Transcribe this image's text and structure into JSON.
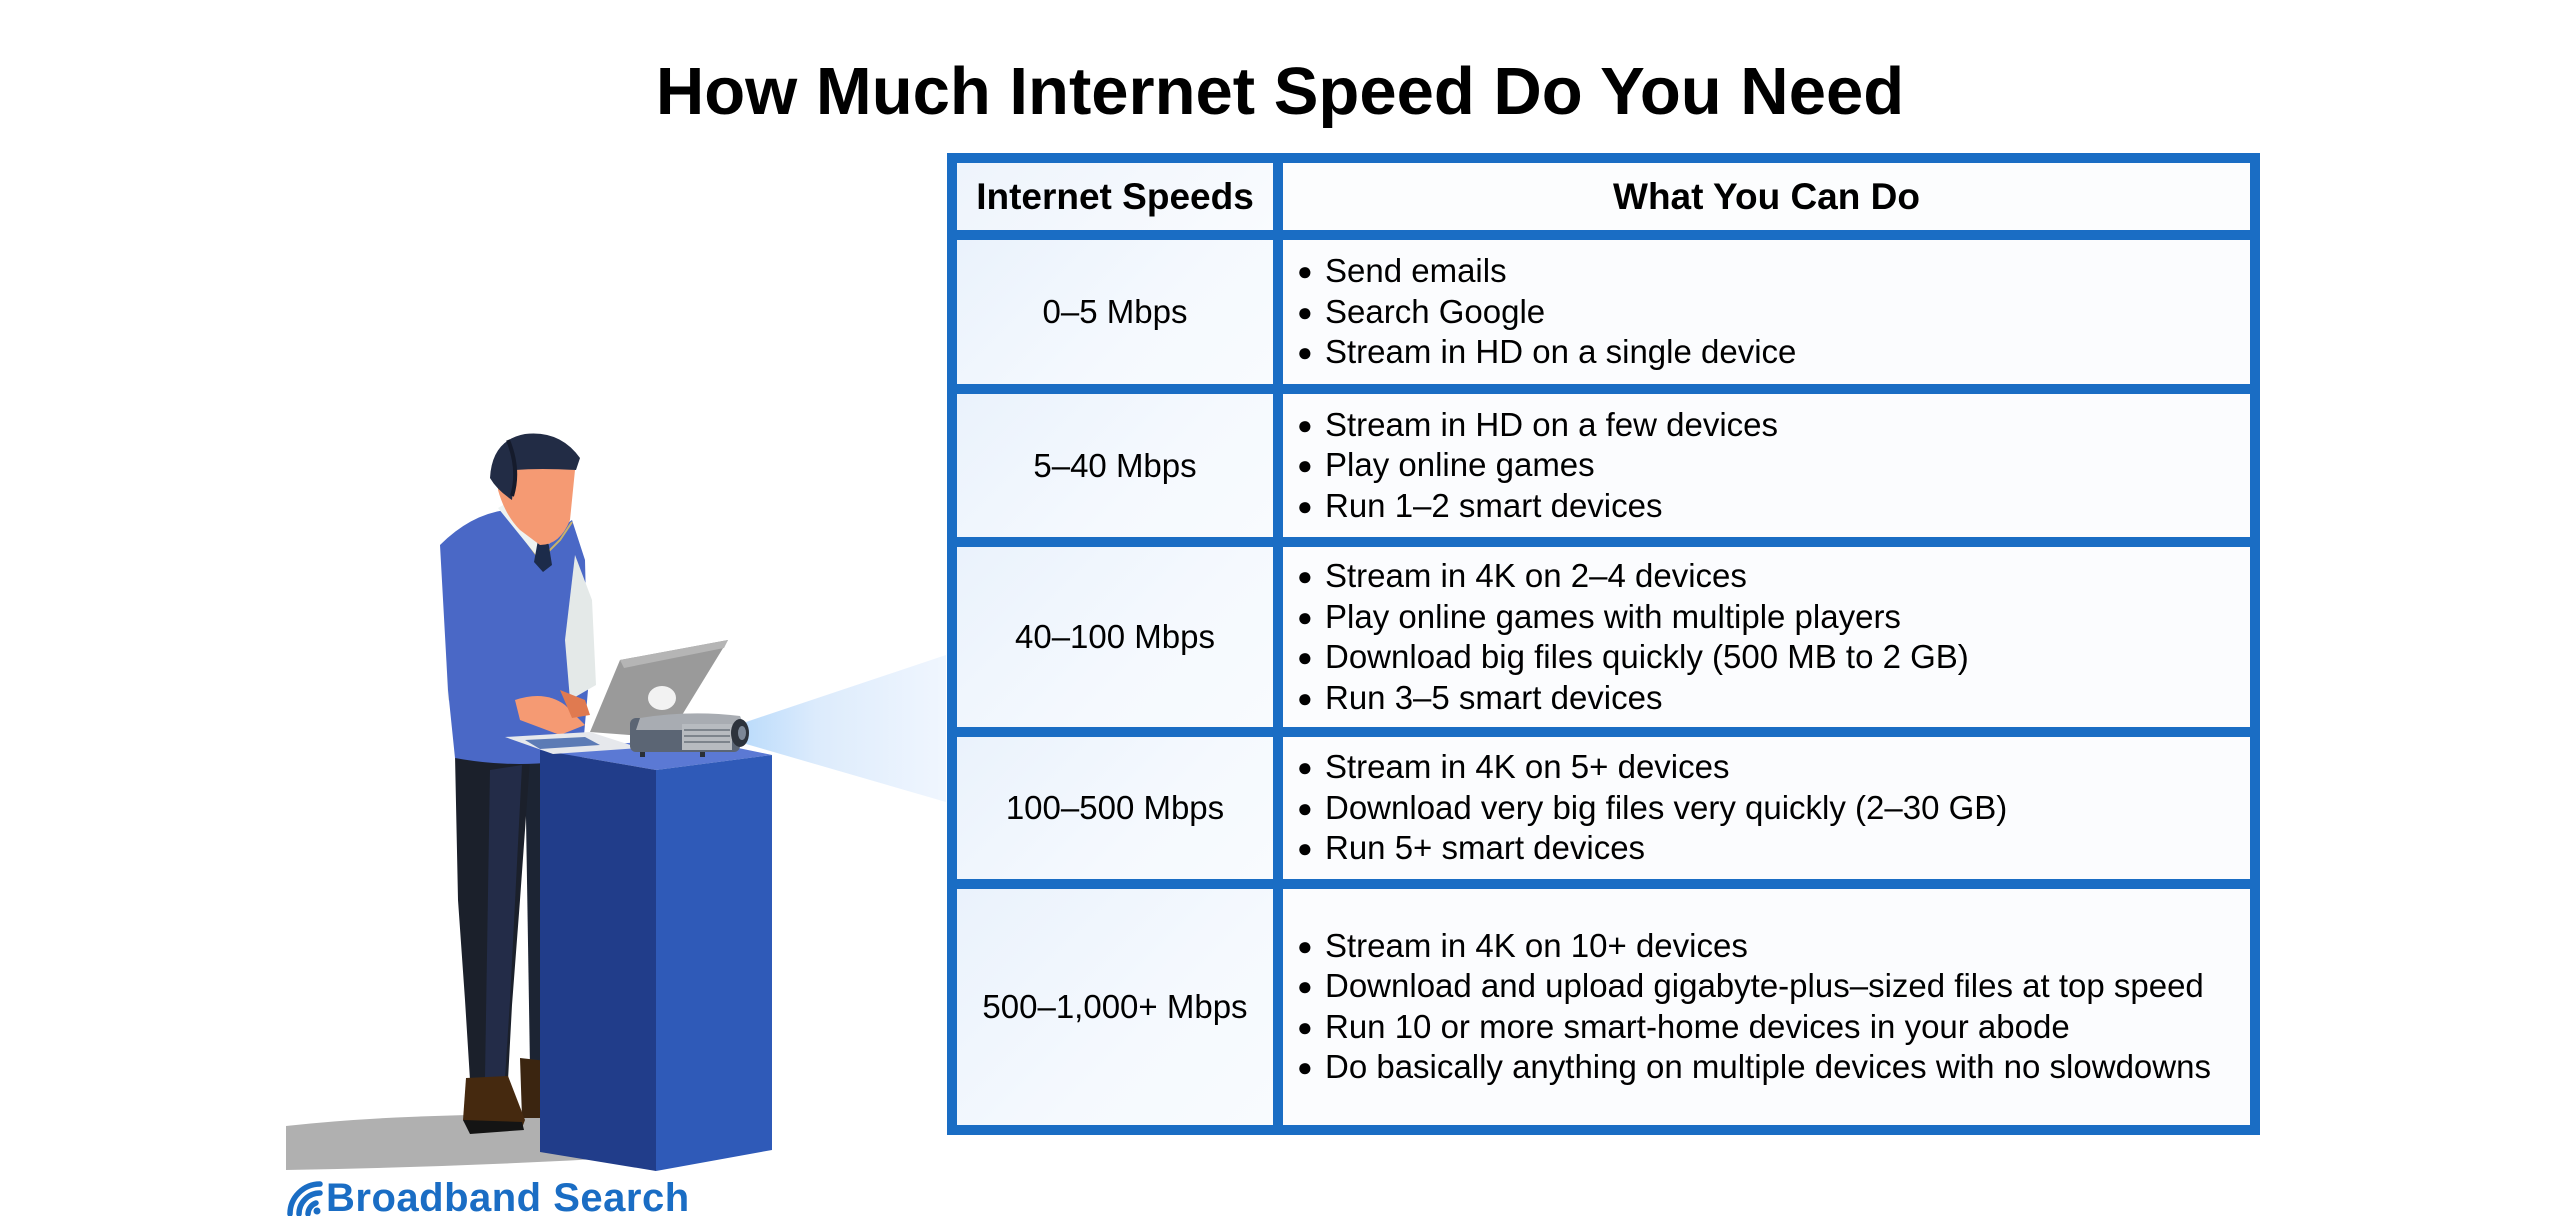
{
  "title": "How Much Internet Speed Do You Need",
  "colors": {
    "table_border": "#1a6dc4",
    "brand": "#1a6dc4",
    "vest": "#4a68c6",
    "pedestal_left": "#213d8a",
    "pedestal_right": "#2f5ab8"
  },
  "table": {
    "headers": [
      "Internet Speeds",
      "What You Can Do"
    ],
    "rows": [
      {
        "speed": "0–5 Mbps",
        "activities": [
          "Send emails",
          "Search Google",
          "Stream in HD on a single device"
        ]
      },
      {
        "speed": "5–40 Mbps",
        "activities": [
          "Stream in HD on a few devices",
          "Play online games",
          "Run 1–2 smart devices"
        ]
      },
      {
        "speed": "40–100 Mbps",
        "activities": [
          "Stream in 4K on 2–4 devices",
          "Play online games with multiple players",
          "Download big files quickly (500 MB to 2 GB)",
          "Run 3–5 smart devices"
        ]
      },
      {
        "speed": "100–500 Mbps",
        "activities": [
          "Stream in 4K on 5+ devices",
          "Download very big files very quickly (2–30 GB)",
          "Run 5+ smart devices"
        ]
      },
      {
        "speed": "500–1,000+ Mbps",
        "activities": [
          "Stream in 4K on 10+ devices",
          "Download and upload gigabyte-plus–sized files at top speed",
          "Run 10 or more smart-home devices in your abode",
          "Do basically anything on multiple devices with no slowdowns"
        ]
      }
    ],
    "bullet": "●"
  },
  "illustration": {
    "subject": "person typing on laptop at pedestal with projector beam",
    "icons": [
      "person-icon",
      "laptop-icon",
      "projector-icon",
      "pedestal-icon",
      "projector-beam"
    ]
  },
  "logo": {
    "icon": "wifi-signal-icon",
    "text": "Broadband Search"
  }
}
